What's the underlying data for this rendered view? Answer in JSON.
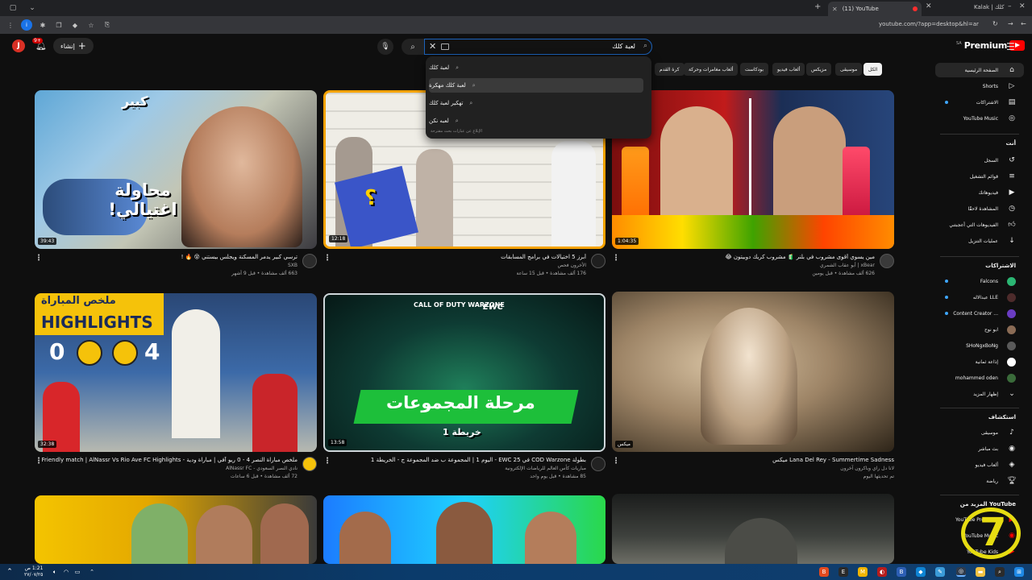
{
  "browser": {
    "tab_title": "(11) YouTube",
    "profile": "Kalak | كلك",
    "url": "youtube.com/?app=desktop&hl=ar"
  },
  "header": {
    "avatar_letter": "J",
    "notif_count": "9+",
    "create_label": "إنشاء",
    "search_query": "لعبة كلك",
    "logo_text": "Premium",
    "logo_region": "SA"
  },
  "suggestions": {
    "items": [
      "لعبة كلك",
      "لعبة كلك مهكرة",
      "تهكير لعبة كلك",
      "لعبه نكن"
    ],
    "report": "الإبلاغ عن عبارات بحث مقترحة"
  },
  "chips": [
    "الكل",
    "موسيقى",
    "مزيكس",
    "ألعاب فيديو",
    "بودكاست",
    "ألعاب مغامرات وحركة",
    "كرة القدم"
  ],
  "videos": [
    {
      "title": "ترسي كبير يدمر المسكنة ويجلس بيستني 😵 🔥 !",
      "channel": "SXB",
      "stats": "663 ألف مشاهدة • قبل 9 أشهر",
      "duration": "39:43",
      "thumb_text_top": "كبير",
      "thumb_text_main": "محاولة اغتيالي!"
    },
    {
      "title": "أبرز 5 اختيالات في برامج المسابقات",
      "channel": "الأخرون فحص",
      "stats": "176 ألف مشاهدة • قبل 15 ساعة",
      "duration": "12:18",
      "thumb_text_main": "؟"
    },
    {
      "title": "مين يسوي أقوى مشروب في بلنر 🧃 مشروب كريك دوبيتون 😂",
      "channel": "xBear | أبو عقاب الشمري",
      "stats": "626 ألف مشاهدة • قبل يومين",
      "duration": "1:04:35"
    },
    {
      "title": "ملخص مباراة النصر 4 - 0 ريو آفي | مباراة ودية - Friendly match | AlNassr Vs Rio Ave FC Highlights",
      "channel": "نادي النصر السعودي - AlNassr FC",
      "stats": "72 ألف مشاهدة • قبل 6 ساعات",
      "duration": "32:38",
      "thumb_text_top": "ملخص المباراة",
      "thumb_text_main": "HIGHLIGHTS",
      "score_left": "0",
      "score_right": "4"
    },
    {
      "title": "بطولة COD Warzone في EWC 25 - اليوم 1 | المجموعة ب ضد المجموعة ج - الخريطة 1",
      "channel": "مباريات كأس العالم للرياضات الإلكترونية",
      "stats": "85 مشاهدة • قبل يوم واحد",
      "duration": "13:58",
      "thumb_text_top": "CALL OF DUTY WARZONE",
      "thumb_text_ewc": "EWC",
      "thumb_text_main": "مرحلة المجموعات",
      "thumb_text_sub": "خريطة 1"
    },
    {
      "title": "Lana Del Rey - Summertime Sadness ميكس",
      "channel": "لانا دل راي وباكرون آخرون",
      "stats": "تم تحديثها اليوم",
      "duration": "ميكس"
    }
  ],
  "sidebar": {
    "main": [
      {
        "label": "الصفحة الرئيسية",
        "icon": "home-icon"
      },
      {
        "label": "Shorts",
        "icon": "shorts-icon"
      },
      {
        "label": "الاشتراكات",
        "icon": "subscriptions-icon"
      },
      {
        "label": "YouTube Music",
        "icon": "music-icon"
      }
    ],
    "you_head": "أنت",
    "you": [
      {
        "label": "السجل",
        "icon": "history-icon"
      },
      {
        "label": "قوائم التشغيل",
        "icon": "playlist-icon"
      },
      {
        "label": "فيديوهاتك",
        "icon": "video-icon"
      },
      {
        "label": "المشاهدة لاحقًا",
        "icon": "clock-icon"
      },
      {
        "label": "الفيديوهات التي أعجبتني",
        "icon": "like-icon"
      },
      {
        "label": "عمليات التنزيل",
        "icon": "download-icon"
      }
    ],
    "subs_head": "الاشتراكات",
    "subs": [
      "Falcons",
      "عبدالاله LLE",
      "Content Creator ...",
      "ابو نوح",
      "SHoNgxBoNg",
      "إذاعة ثمانية",
      "mohammed oden",
      "إظهار المزيد"
    ],
    "explore_head": "استكشاف",
    "explore": [
      {
        "label": "موسيقى",
        "icon": "note-icon"
      },
      {
        "label": "بث مباشر",
        "icon": "live-icon"
      },
      {
        "label": "ألعاب فيديو",
        "icon": "game-icon"
      },
      {
        "label": "رياضة",
        "icon": "trophy-icon"
      }
    ],
    "more_head": "المزيد من YouTube",
    "more": [
      "YouTube Premium",
      "YouTube Music",
      "YouTube Kids"
    ]
  },
  "taskbar": {
    "time": "1:21 ص",
    "date": "٢٧/٠٧/٢٥"
  }
}
